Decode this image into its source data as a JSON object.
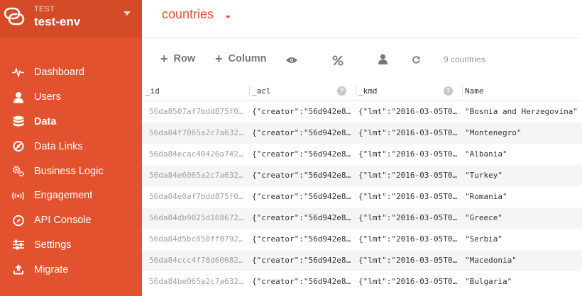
{
  "app": {
    "env_label": "TEST",
    "env_name": "test-env"
  },
  "sidebar": {
    "items": [
      {
        "label": "Dashboard",
        "icon": "pulse-icon"
      },
      {
        "label": "Users",
        "icon": "user-icon"
      },
      {
        "label": "Data",
        "icon": "database-icon",
        "active": true
      },
      {
        "label": "Data Links",
        "icon": "link-icon"
      },
      {
        "label": "Business Logic",
        "icon": "gears-icon"
      },
      {
        "label": "Engagement",
        "icon": "broadcast-icon"
      },
      {
        "label": "API Console",
        "icon": "compass-icon"
      },
      {
        "label": "Settings",
        "icon": "sliders-icon"
      },
      {
        "label": "Migrate",
        "icon": "upload-icon"
      }
    ]
  },
  "main": {
    "table_name": "countries",
    "toolbar": {
      "add_row": "Row",
      "add_column": "Column",
      "count": "9 countries"
    },
    "columns": [
      "_id",
      "_acl",
      "_kmd",
      "Name"
    ],
    "rows": [
      {
        "id": "56da8507af7bdd875f0…",
        "acl": "{\"creator\":\"56d942e8…",
        "kmd": "{\"lmt\":\"2016-03-05T0…",
        "name": "\"Bosnia and Herzegovina\""
      },
      {
        "id": "56da84f7065a2c7a632…",
        "acl": "{\"creator\":\"56d942e8…",
        "kmd": "{\"lmt\":\"2016-03-05T0…",
        "name": "\"Montenegro\""
      },
      {
        "id": "56da84ecac40426a742…",
        "acl": "{\"creator\":\"56d942e8…",
        "kmd": "{\"lmt\":\"2016-03-05T0…",
        "name": "\"Albania\""
      },
      {
        "id": "56da84e6065a2c7a632…",
        "acl": "{\"creator\":\"56d942e8…",
        "kmd": "{\"lmt\":\"2016-03-05T0…",
        "name": "\"Turkey\""
      },
      {
        "id": "56da84e0af7bdd875f0…",
        "acl": "{\"creator\":\"56d942e8…",
        "kmd": "{\"lmt\":\"2016-03-05T0…",
        "name": "\"Romania\""
      },
      {
        "id": "56da84db9025d168672…",
        "acl": "{\"creator\":\"56d942e8…",
        "kmd": "{\"lmt\":\"2016-03-05T0…",
        "name": "\"Greece\""
      },
      {
        "id": "56da84d5bc050ff8792…",
        "acl": "{\"creator\":\"56d942e8…",
        "kmd": "{\"lmt\":\"2016-03-05T0…",
        "name": "\"Serbia\""
      },
      {
        "id": "56da84ccc4f78d60682…",
        "acl": "{\"creator\":\"56d942e8…",
        "kmd": "{\"lmt\":\"2016-03-05T0…",
        "name": "\"Macedonia\""
      },
      {
        "id": "56da84be065a2c7a632…",
        "acl": "{\"creator\":\"56d942e8…",
        "kmd": "{\"lmt\":\"2016-03-05T0…",
        "name": "\"Bulgaria\""
      }
    ]
  },
  "colors": {
    "brand": "#e2522e",
    "brand_dark": "#d54a27"
  }
}
